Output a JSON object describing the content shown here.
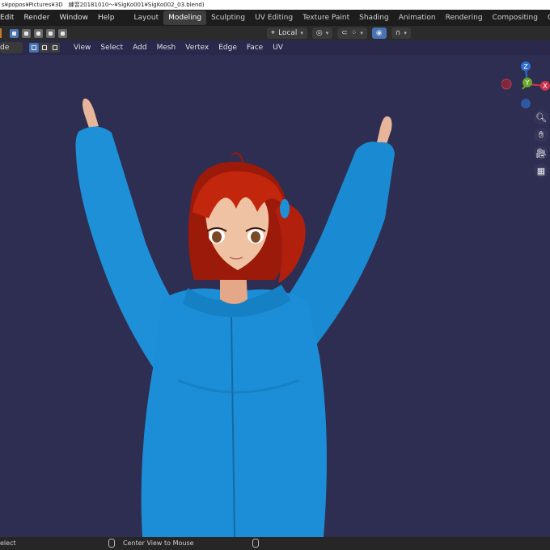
{
  "window": {
    "title": "s¥popos¥Pictures¥3D　練習20181010～¥SigKo001¥SigKo002_03.blend)"
  },
  "menus": [
    "Edit",
    "Render",
    "Window",
    "Help"
  ],
  "workspaces": [
    {
      "label": "Layout",
      "active": false
    },
    {
      "label": "Modeling",
      "active": true
    },
    {
      "label": "Sculpting",
      "active": false
    },
    {
      "label": "UV Editing",
      "active": false
    },
    {
      "label": "Texture Paint",
      "active": false
    },
    {
      "label": "Shading",
      "active": false
    },
    {
      "label": "Animation",
      "active": false
    },
    {
      "label": "Rendering",
      "active": false
    },
    {
      "label": "Compositing",
      "active": false
    },
    {
      "label": "Geometry Nod",
      "active": false
    }
  ],
  "toolbar": {
    "transform_orientation": "Local"
  },
  "viewport_header": {
    "mode_label": "de",
    "menus": [
      "View",
      "Select",
      "Add",
      "Mesh",
      "Vertex",
      "Edge",
      "Face",
      "UV"
    ]
  },
  "gizmo": {
    "axes": [
      "Z",
      "Y",
      "X"
    ]
  },
  "nav_icons": [
    "zoom-icon",
    "hand-pan-icon",
    "camera-icon",
    "grid-ortho-icon"
  ],
  "statusbar": {
    "left": "elect",
    "center": "Center View to Mouse"
  },
  "colors": {
    "background": "#2e2d52",
    "accent": "#4772b3",
    "hoodie": "#1f8fd6",
    "hair": "#b4200c"
  }
}
